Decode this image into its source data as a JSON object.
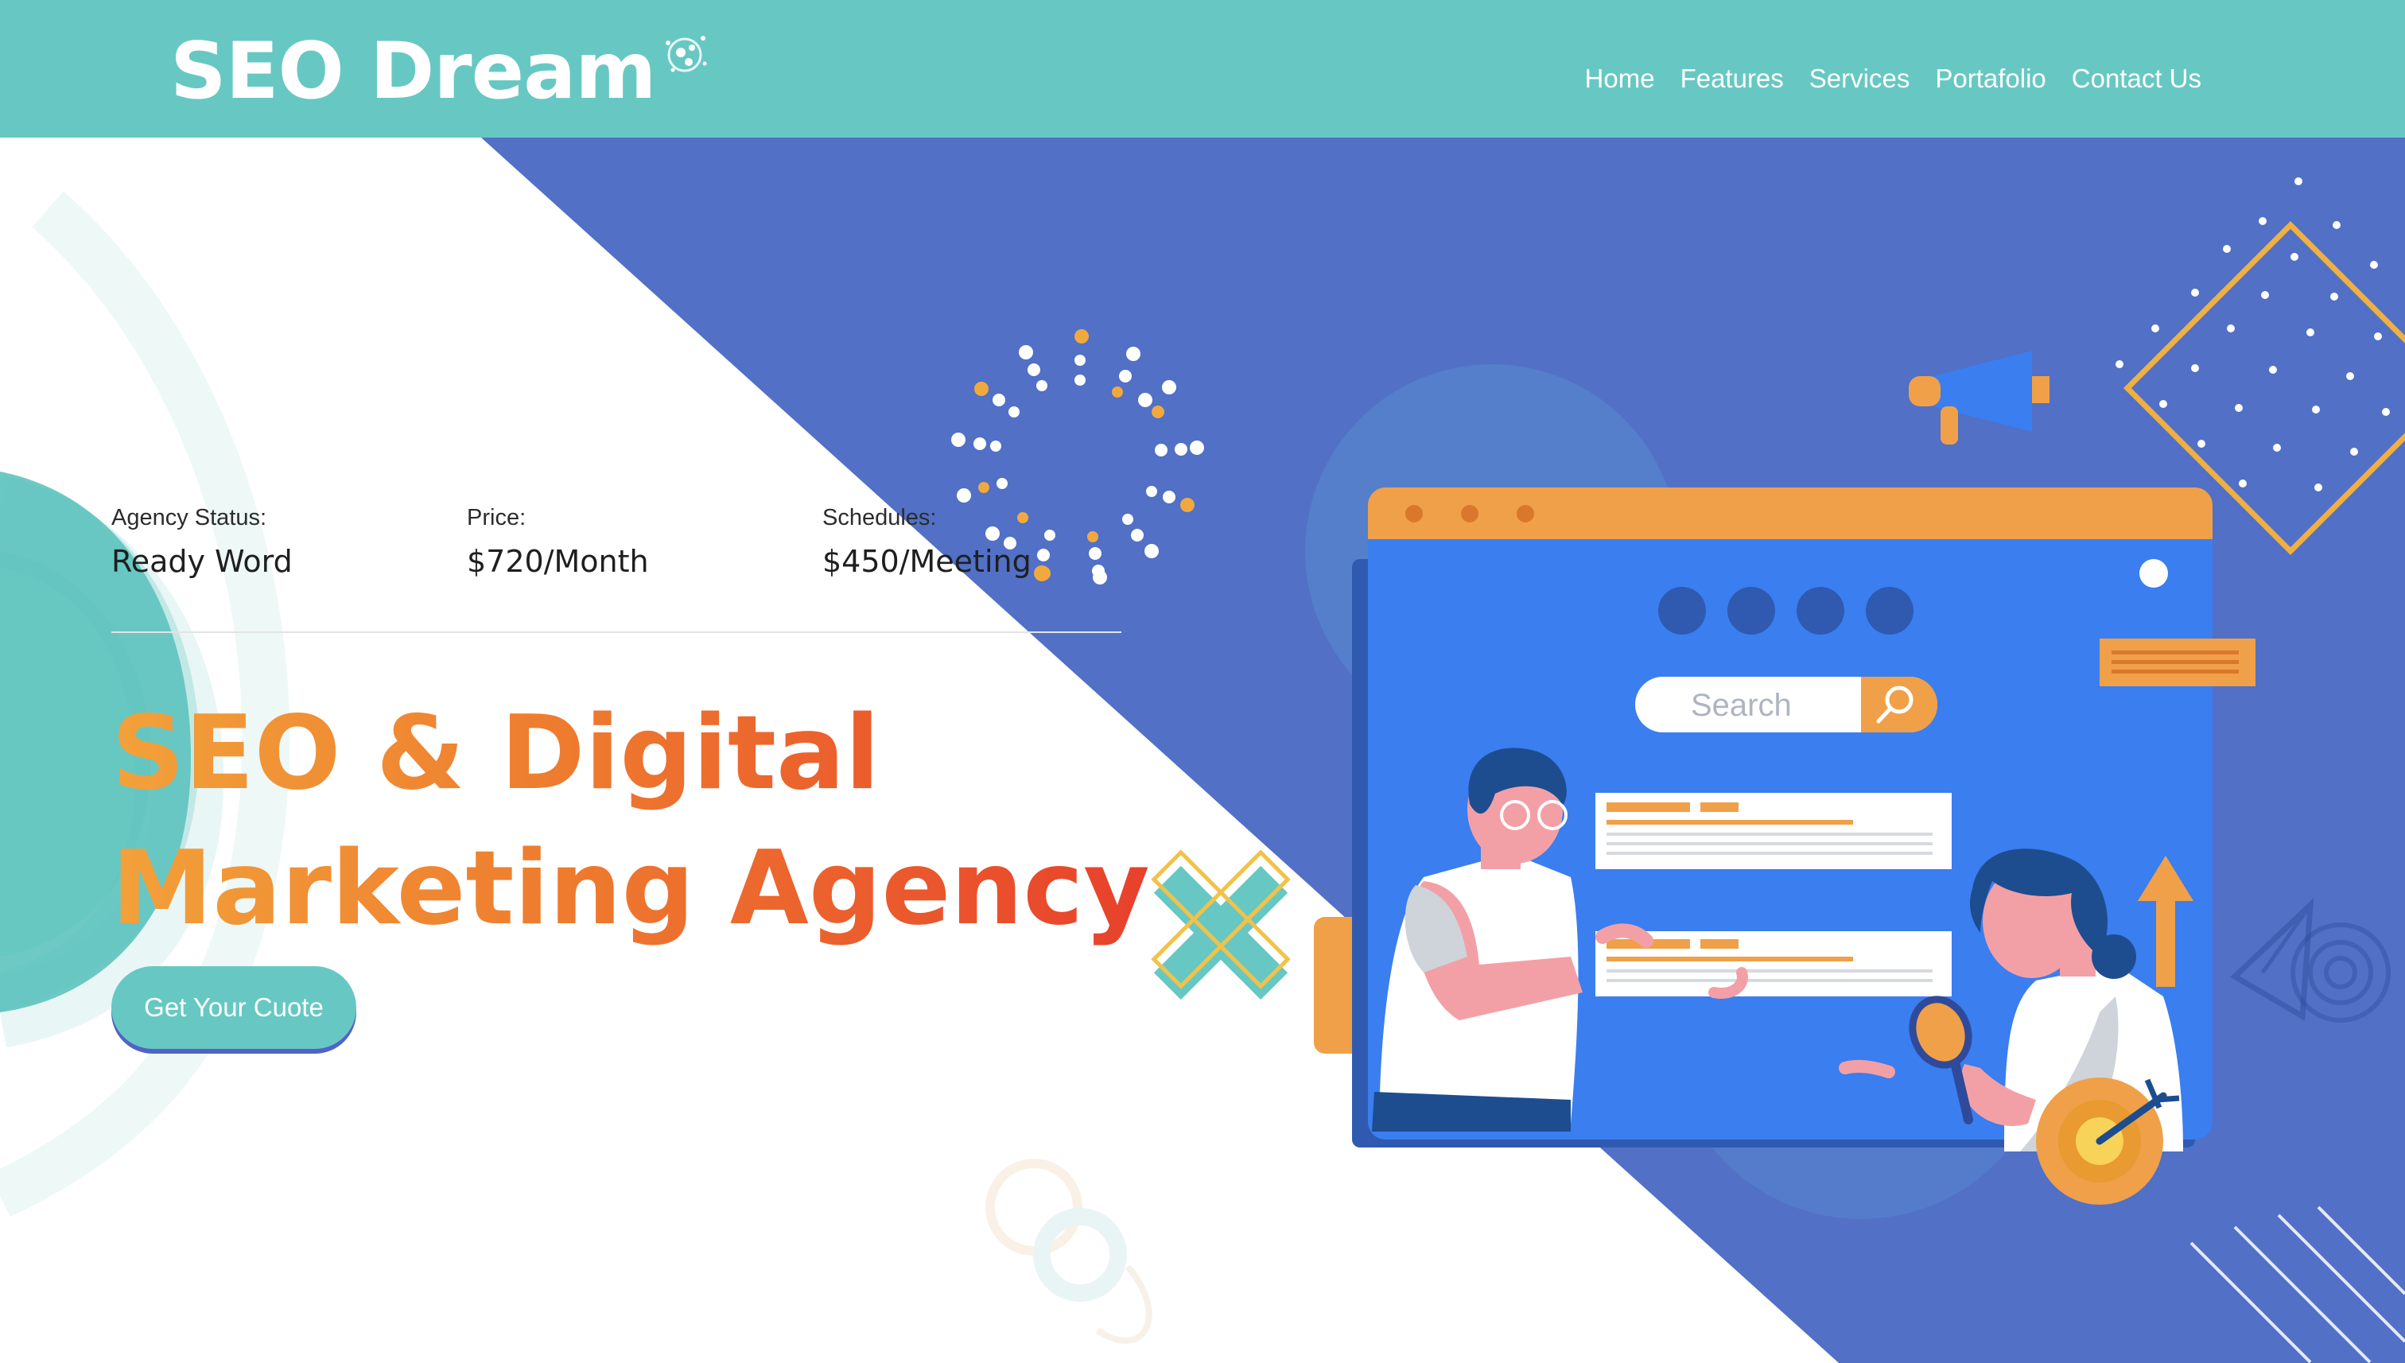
{
  "brand": {
    "name": "SEO Dream"
  },
  "nav": [
    "Home",
    "Features",
    "Services",
    "Portafolio",
    "Contact Us"
  ],
  "hero": {
    "stats": [
      {
        "label": "Agency Status:",
        "value": "Ready Word"
      },
      {
        "label": "Price:",
        "value": "$720/Month"
      },
      {
        "label": "Schedules:",
        "value": "$450/Meeting"
      }
    ],
    "title_line1": "SEO & Digital",
    "title_line2": "Marketing Agency",
    "cta": "Get Your Cuote",
    "illustration": {
      "search_placeholder": "Search"
    }
  },
  "colors": {
    "primary": "#67c8c3",
    "hero_blue": "#5170c6",
    "browser_blue": "#3a7ef0",
    "orange": "#f0a048",
    "headline_start": "#f2a13a",
    "headline_end": "#e8402c"
  },
  "icons": [
    "logo-dots-icon",
    "megaphone-icon",
    "magnifier-icon",
    "target-icon",
    "arrow-up-icon",
    "paper-plane-icon",
    "cross-icon"
  ]
}
